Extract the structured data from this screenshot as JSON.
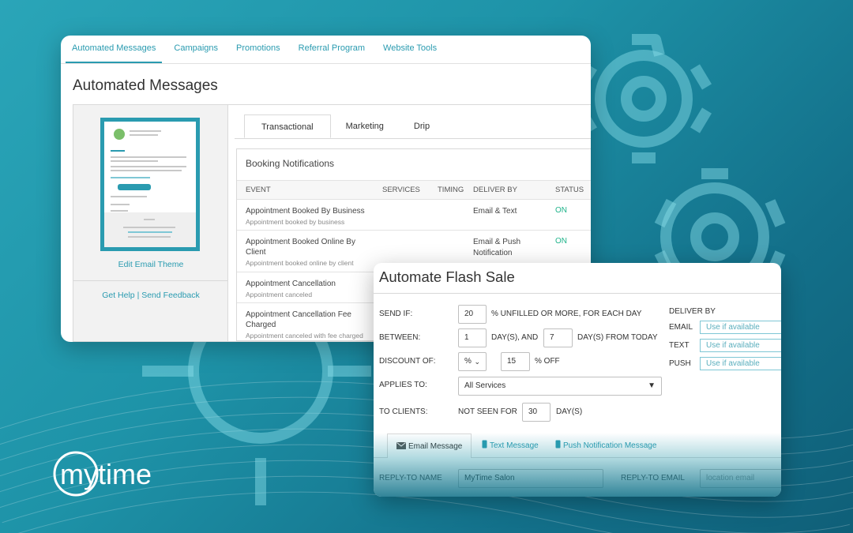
{
  "colors": {
    "accent": "#2a9bb0",
    "status_on": "#1fb38a",
    "bg_teal": "#1e93a8"
  },
  "nav": {
    "tabs": [
      {
        "label": "Automated Messages",
        "active": true
      },
      {
        "label": "Campaigns"
      },
      {
        "label": "Promotions"
      },
      {
        "label": "Referral Program"
      },
      {
        "label": "Website Tools"
      }
    ]
  },
  "page": {
    "title": "Automated Messages"
  },
  "sidebar": {
    "edit_theme": "Edit Email Theme",
    "get_help": "Get Help",
    "separator": "|",
    "send_feedback": "Send Feedback"
  },
  "sub_tabs": [
    {
      "label": "Transactional",
      "active": true
    },
    {
      "label": "Marketing"
    },
    {
      "label": "Drip"
    }
  ],
  "notifications": {
    "title": "Booking Notifications",
    "columns": [
      "EVENT",
      "SERVICES",
      "TIMING",
      "DELIVER BY",
      "STATUS"
    ],
    "rows": [
      {
        "event": "Appointment Booked By Business",
        "sub": "Appointment booked by business",
        "deliver": "Email & Text",
        "status": "ON"
      },
      {
        "event": "Appointment Booked Online By Client",
        "sub": "Appointment booked online by client",
        "deliver": "Email & Push Notification",
        "status": "ON"
      },
      {
        "event": "Appointment Cancellation",
        "sub": "Appointment canceled",
        "deliver": "",
        "status": ""
      },
      {
        "event": "Appointment Cancellation Fee Charged",
        "sub": "Appointment canceled with fee charged",
        "deliver": "",
        "status": ""
      }
    ]
  },
  "flash_sale": {
    "title": "Automate Flash Sale",
    "send_if_label": "SEND IF:",
    "send_if_value": "20",
    "send_if_suffix": "% UNFILLED OR MORE, FOR EACH DAY",
    "between_label": "BETWEEN:",
    "between_from": "1",
    "between_mid": "DAY(S), AND",
    "between_to": "7",
    "between_suffix": "DAY(S) FROM TODAY",
    "discount_label": "DISCOUNT OF:",
    "discount_type": "%",
    "discount_value": "15",
    "discount_suffix": "% OFF",
    "applies_label": "APPLIES TO:",
    "applies_value": "All Services",
    "clients_label": "TO CLIENTS:",
    "clients_prefix": "NOT SEEN FOR",
    "clients_value": "30",
    "clients_suffix": "DAY(S)",
    "deliver_by_label": "DELIVER BY",
    "deliver": [
      {
        "channel": "EMAIL",
        "value": "Use if available"
      },
      {
        "channel": "TEXT",
        "value": "Use if available"
      },
      {
        "channel": "PUSH",
        "value": "Use if available"
      }
    ],
    "tabs": [
      {
        "label": "Email Message",
        "icon": "envelope-icon",
        "active": true
      },
      {
        "label": "Text Message",
        "icon": "phone-icon"
      },
      {
        "label": "Push Notification Message",
        "icon": "phone-icon"
      }
    ],
    "reply_to_name_label": "REPLY-TO NAME",
    "reply_to_name_value": "MyTime Salon",
    "reply_to_email_label": "REPLY-TO EMAIL",
    "reply_to_email_placeholder": "location email"
  },
  "brand": {
    "logo_text": "mytime",
    "logo_icon": "mytime-logo-icon"
  }
}
